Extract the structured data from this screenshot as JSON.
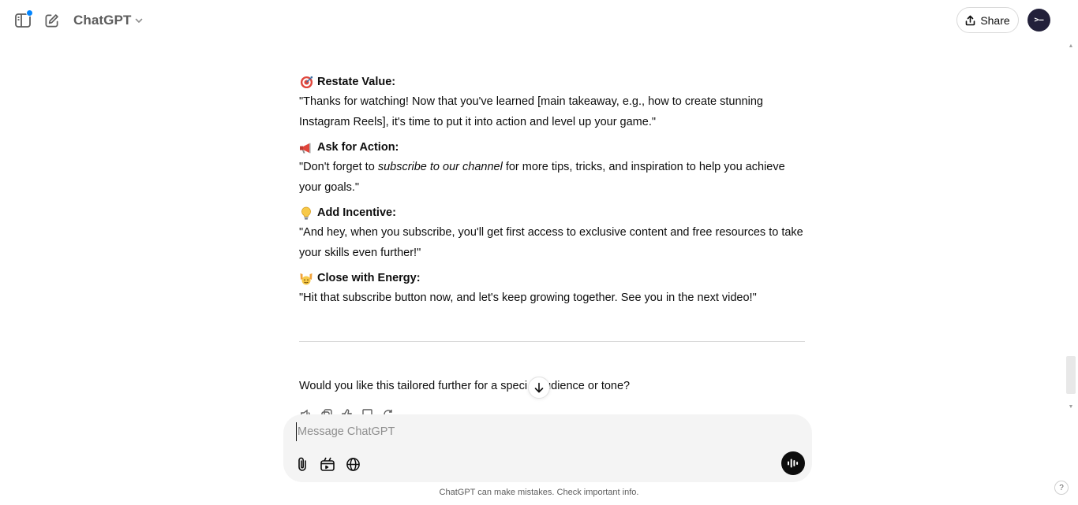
{
  "header": {
    "model_name": "ChatGPT",
    "share_label": "Share",
    "avatar_text": ">‒"
  },
  "sections": [
    {
      "emoji": "target",
      "title": "Restate Value:",
      "text": "\"Thanks for watching! Now that you've learned [main takeaway, e.g., how to create stunning Instagram Reels], it's time to put it into action and level up your game.\""
    },
    {
      "emoji": "megaphone",
      "title": "Ask for Action:",
      "text_before": "\"Don't forget to ",
      "text_em": "subscribe to our channel",
      "text_after": " for more tips, tricks, and inspiration to help you achieve your goals.\""
    },
    {
      "emoji": "lightbulb",
      "title": "Add Incentive:",
      "text": "\"And hey, when you subscribe, you'll get first access to exclusive content and free resources to take your skills even further!\""
    },
    {
      "emoji": "raised-hands",
      "title": "Close with Energy:",
      "text": "\"Hit that subscribe button now, and let's keep growing together. See you in the next video!\""
    }
  ],
  "followup": {
    "before": "Would you like this tailored further for a speci",
    "after": "udience or tone?"
  },
  "composer": {
    "placeholder": "Message ChatGPT"
  },
  "disclaimer": "ChatGPT can make mistakes. Check important info.",
  "help_label": "?",
  "colors": {
    "notification_dot": "#0285ff",
    "avatar_bg": "#22203a",
    "composer_bg": "#f4f4f4",
    "voice_button": "#0d0d0d"
  }
}
